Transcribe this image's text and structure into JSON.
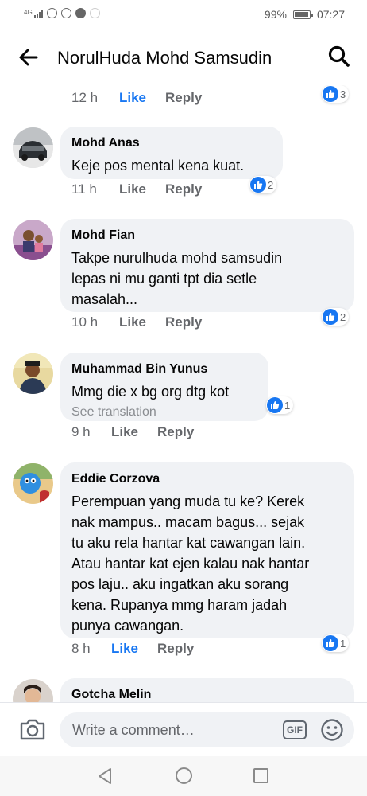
{
  "status_bar": {
    "network": "4G",
    "battery": "99%",
    "time": "07:27"
  },
  "header": {
    "title": "NorulHuda Mohd Samsudin"
  },
  "comments": [
    {
      "author": "",
      "text": [],
      "time": "12 h",
      "like_label": "Like",
      "reply_label": "Reply",
      "liked": true,
      "reaction_count": "3"
    },
    {
      "author": "Mohd Anas",
      "text": [
        "Keje pos mental kena kuat."
      ],
      "time": "11 h",
      "like_label": "Like",
      "reply_label": "Reply",
      "liked": false,
      "reaction_count": "2"
    },
    {
      "author": "Mohd Fian",
      "text": [
        "Takpe nurulhuda mohd samsudin",
        "lepas ni mu ganti tpt dia setle",
        "masalah..."
      ],
      "time": "10 h",
      "like_label": "Like",
      "reply_label": "Reply",
      "liked": false,
      "reaction_count": "2"
    },
    {
      "author": "Muhammad Bin Yunus",
      "text": [
        "Mmg die x bg org dtg kot"
      ],
      "see_translation": "See translation",
      "time": "9 h",
      "like_label": "Like",
      "reply_label": "Reply",
      "liked": false,
      "reaction_count": "1"
    },
    {
      "author": "Eddie Corzova",
      "text": [
        "Perempuan yang muda tu ke? Kerek",
        "nak mampus.. macam bagus... sejak",
        "tu aku rela hantar kat cawangan lain.",
        "Atau hantar kat ejen kalau nak hantar",
        "pos laju.. aku ingatkan aku sorang",
        "kena. Rupanya mmg haram jadah",
        "punya cawangan."
      ],
      "time": "8 h",
      "like_label": "Like",
      "reply_label": "Reply",
      "liked": true,
      "reaction_count": "1"
    },
    {
      "author": "Gotcha Melin",
      "text": []
    }
  ],
  "composer": {
    "placeholder": "Write a comment…",
    "gif_label": "GIF"
  },
  "colors": {
    "accent": "#1877f2",
    "bubble": "#f0f2f5",
    "secondary_text": "#65676b"
  }
}
